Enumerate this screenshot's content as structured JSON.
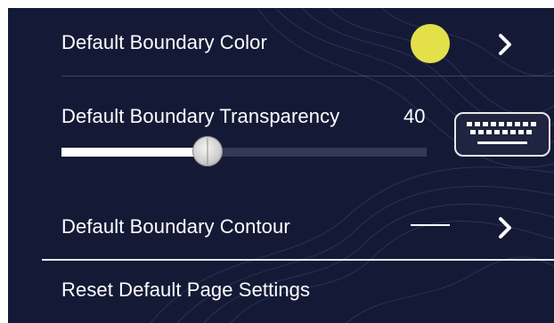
{
  "settings": {
    "boundary_color": {
      "label": "Default Boundary Color",
      "swatch_color": "#e3e04a",
      "icon": "chevron-right-icon"
    },
    "boundary_transparency": {
      "label": "Default Boundary Transparency",
      "value": "40",
      "slider_percent": 40,
      "keyboard_icon": "keyboard-icon"
    },
    "boundary_contour": {
      "label": "Default Boundary Contour",
      "line_style": "solid",
      "icon": "chevron-right-icon"
    },
    "reset": {
      "label": "Reset Default Page Settings"
    }
  },
  "colors": {
    "background": "#141a36",
    "slider_track": "#333a56",
    "text": "#ffffff"
  }
}
